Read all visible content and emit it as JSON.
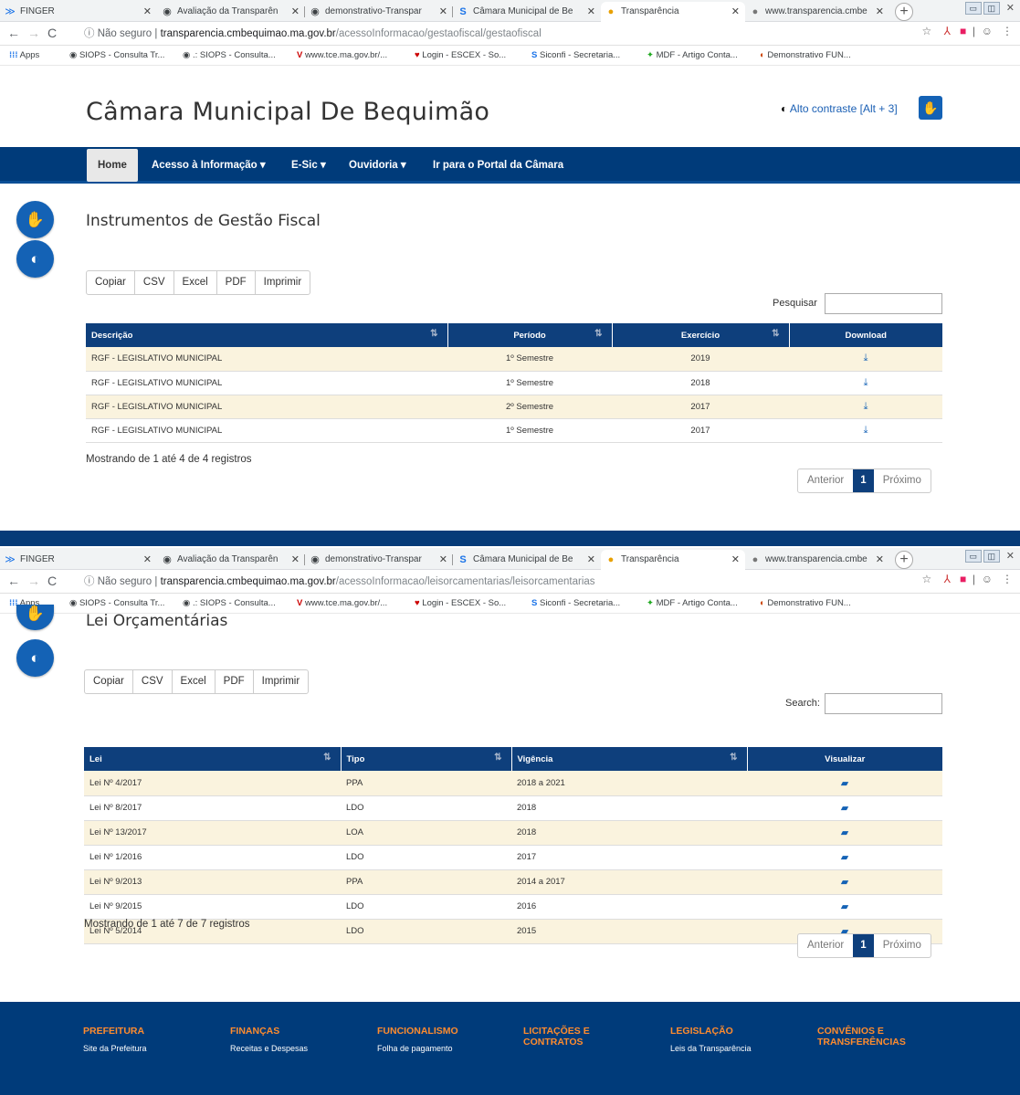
{
  "browser": {
    "tabs": [
      {
        "icon": "finger-icon",
        "label": "FINGER"
      },
      {
        "icon": "globe-icon",
        "label": "Avaliação da Transparên"
      },
      {
        "icon": "globe-icon",
        "label": "demonstrativo-Transpar"
      },
      {
        "icon": "siconfi-icon",
        "label": "Câmara Municipal de Be"
      },
      {
        "icon": "info-icon",
        "label": "Transparência"
      },
      {
        "icon": "site-icon",
        "label": "www.transparencia.cmbe"
      }
    ],
    "not_secure": "Não seguro",
    "host": "transparencia.cmbequimao.ma.gov.br",
    "path_1": "/acessoInformacao/gestaofiscal/gestaofiscal",
    "path_2": "/acessoInformacao/leisorcamentarias/leisorcamentarias",
    "bookmarks": [
      "Apps",
      "SIOPS - Consulta Tr...",
      ".: SIOPS - Consulta...",
      "www.tce.ma.gov.br/...",
      "Login - ESCEX - So...",
      "Siconfi - Secretaria...",
      "MDF - Artigo Conta...",
      "Demonstrativo FUN..."
    ]
  },
  "site": {
    "title": "Câmara Municipal De Bequimão",
    "contrast_label": "Alto contraste [Alt + 3]",
    "nav": [
      "Home",
      "Acesso à Informação ▾",
      "E-Sic ▾",
      "Ouvidoria ▾",
      "Ir para o Portal da Câmara"
    ]
  },
  "export_buttons": [
    "Copiar",
    "CSV",
    "Excel",
    "PDF",
    "Imprimir"
  ],
  "section1": {
    "title": "Instrumentos de Gestão Fiscal",
    "search_label": "Pesquisar",
    "columns": [
      "Descrição",
      "Período",
      "Exercício",
      "Download"
    ],
    "rows": [
      [
        "RGF - LEGISLATIVO MUNICIPAL",
        "1º Semestre",
        "2019"
      ],
      [
        "RGF - LEGISLATIVO MUNICIPAL",
        "1º Semestre",
        "2018"
      ],
      [
        "RGF - LEGISLATIVO MUNICIPAL",
        "2º Semestre",
        "2017"
      ],
      [
        "RGF - LEGISLATIVO MUNICIPAL",
        "1º Semestre",
        "2017"
      ]
    ],
    "info": "Mostrando de 1 até 4 de 4 registros"
  },
  "section2": {
    "title": "Lei Orçamentárias",
    "search_label": "Search:",
    "columns": [
      "Lei",
      "Tipo",
      "Vigência",
      "Visualizar"
    ],
    "rows": [
      [
        "Lei Nº 4/2017",
        "PPA",
        "2018 a 2021"
      ],
      [
        "Lei Nº 8/2017",
        "LDO",
        "2018"
      ],
      [
        "Lei Nº 13/2017",
        "LOA",
        "2018"
      ],
      [
        "Lei Nº 1/2016",
        "LDO",
        "2017"
      ],
      [
        "Lei Nº 9/2013",
        "PPA",
        "2014 a 2017"
      ],
      [
        "Lei Nº 9/2015",
        "LDO",
        "2016"
      ],
      [
        "Lei Nº 5/2014",
        "LDO",
        "2015"
      ]
    ],
    "info": "Mostrando de 1 até 7 de 7 registros"
  },
  "pager": {
    "prev": "Anterior",
    "current": "1",
    "next": "Próximo"
  },
  "footer": {
    "cols": [
      {
        "title": "PREFEITURA",
        "link": "Site da Prefeitura"
      },
      {
        "title": "FINANÇAS",
        "link": "Receitas e Despesas"
      },
      {
        "title": "FUNCIONALISMO",
        "link": "Folha de pagamento"
      },
      {
        "title": "LICITAÇÕES E CONTRATOS",
        "link": ""
      },
      {
        "title": "LEGISLAÇÃO",
        "link": "Leis da Transparência"
      },
      {
        "title": "CONVÊNIOS E TRANSFERÊNCIAS",
        "link": ""
      }
    ]
  },
  "colors": {
    "nav": "#003b7a",
    "header": "#0e3f7c",
    "accent": "#ff8c2e",
    "stripe": "#faf3de"
  }
}
